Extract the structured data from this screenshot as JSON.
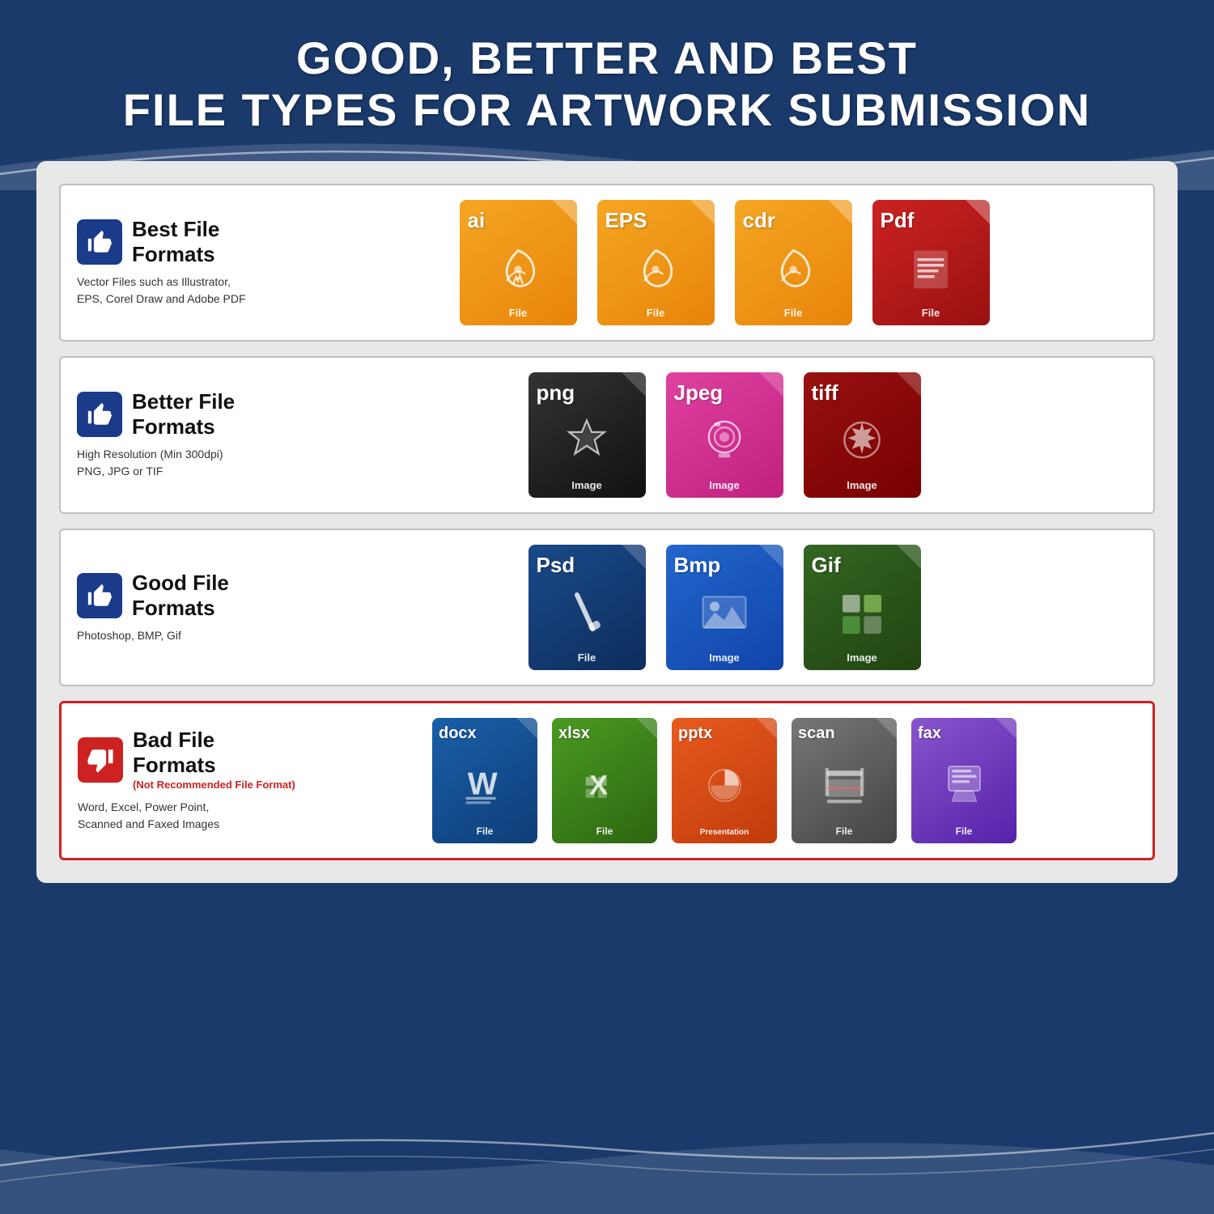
{
  "header": {
    "line1": "GOOD, BETTER AND BEST",
    "line2": "FILE TYPES FOR ARTWORK SUBMISSION"
  },
  "rows": [
    {
      "id": "best",
      "category": "Best File Formats",
      "subtitle": null,
      "description": "Vector Files such as Illustrator,\nEPS, Corel Draw and Adobe PDF",
      "thumbType": "thumbs-up",
      "thumbColor": "blue",
      "borderColor": "normal",
      "files": [
        {
          "ext": "ai",
          "label": "File",
          "color": "orange",
          "visual": "✦",
          "visualType": "pen"
        },
        {
          "ext": "EPS",
          "label": "File",
          "color": "orange",
          "visual": "✦",
          "visualType": "pen"
        },
        {
          "ext": "cdr",
          "label": "File",
          "color": "orange",
          "visual": "✦",
          "visualType": "pen"
        },
        {
          "ext": "Pdf",
          "label": "File",
          "color": "red-dark",
          "visual": "≡",
          "visualType": "doc"
        }
      ]
    },
    {
      "id": "better",
      "category": "Better File Formats",
      "subtitle": null,
      "description": "High Resolution (Min 300dpi)\nPNG, JPG or TIF",
      "thumbType": "thumbs-up",
      "thumbColor": "blue",
      "borderColor": "normal",
      "files": [
        {
          "ext": "png",
          "label": "Image",
          "color": "dark-gray",
          "visual": "✦",
          "visualType": "star"
        },
        {
          "ext": "Jpeg",
          "label": "Image",
          "color": "pink",
          "visual": "📷",
          "visualType": "camera"
        },
        {
          "ext": "tiff",
          "label": "Image",
          "color": "dark-red",
          "visual": "✿",
          "visualType": "flower"
        }
      ]
    },
    {
      "id": "good",
      "category": "Good File Formats",
      "subtitle": null,
      "description": "Photoshop, BMP, Gif",
      "thumbType": "thumbs-up",
      "thumbColor": "blue",
      "borderColor": "normal",
      "files": [
        {
          "ext": "Psd",
          "label": "File",
          "color": "blue-dark",
          "visual": "✏",
          "visualType": "brush"
        },
        {
          "ext": "Bmp",
          "label": "Image",
          "color": "blue-medium",
          "visual": "🏔",
          "visualType": "landscape"
        },
        {
          "ext": "Gif",
          "label": "Image",
          "color": "green-dark",
          "visual": "⊞",
          "visualType": "grid"
        }
      ]
    },
    {
      "id": "bad",
      "category": "Bad File Formats",
      "subtitle": "(Not Recommended File Format)",
      "description": "Word, Excel, Power Point,\nScanned and Faxed Images",
      "thumbType": "thumbs-down",
      "thumbColor": "red",
      "borderColor": "bad",
      "files": [
        {
          "ext": "docx",
          "label": "File",
          "color": "blue-word",
          "visual": "W",
          "visualType": "word"
        },
        {
          "ext": "xlsx",
          "label": "File",
          "color": "green-excel",
          "visual": "X",
          "visualType": "excel"
        },
        {
          "ext": "pptx",
          "label": "Presentation",
          "color": "orange-ppt",
          "visual": "◉",
          "visualType": "ppt"
        },
        {
          "ext": "scan",
          "label": "File",
          "color": "gray-scan",
          "visual": "▤",
          "visualType": "scan"
        },
        {
          "ext": "fax",
          "label": "File",
          "color": "purple-fax",
          "visual": "📄",
          "visualType": "fax"
        }
      ]
    }
  ]
}
